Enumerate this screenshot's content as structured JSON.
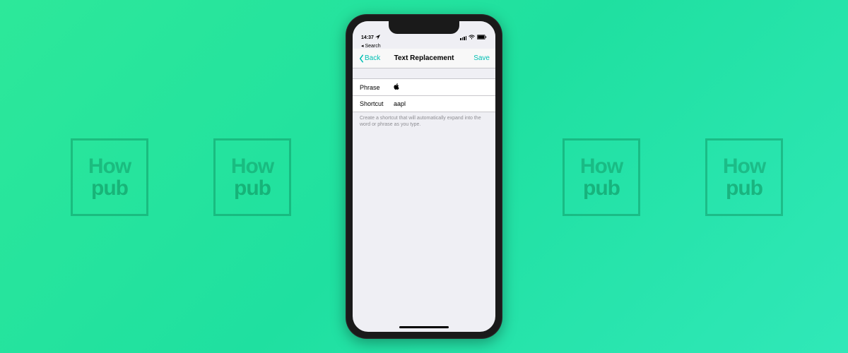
{
  "watermark": {
    "line1": "How",
    "line2": "pub"
  },
  "statusbar": {
    "search": "Search",
    "time": "14:37"
  },
  "nav": {
    "back": "Back",
    "title": "Text Replacement",
    "save": "Save"
  },
  "form": {
    "phrase_label": "Phrase",
    "phrase_value": "",
    "shortcut_label": "Shortcut",
    "shortcut_value": "aapl",
    "hint": "Create a shortcut that will automatically expand into the word or phrase as you type."
  }
}
